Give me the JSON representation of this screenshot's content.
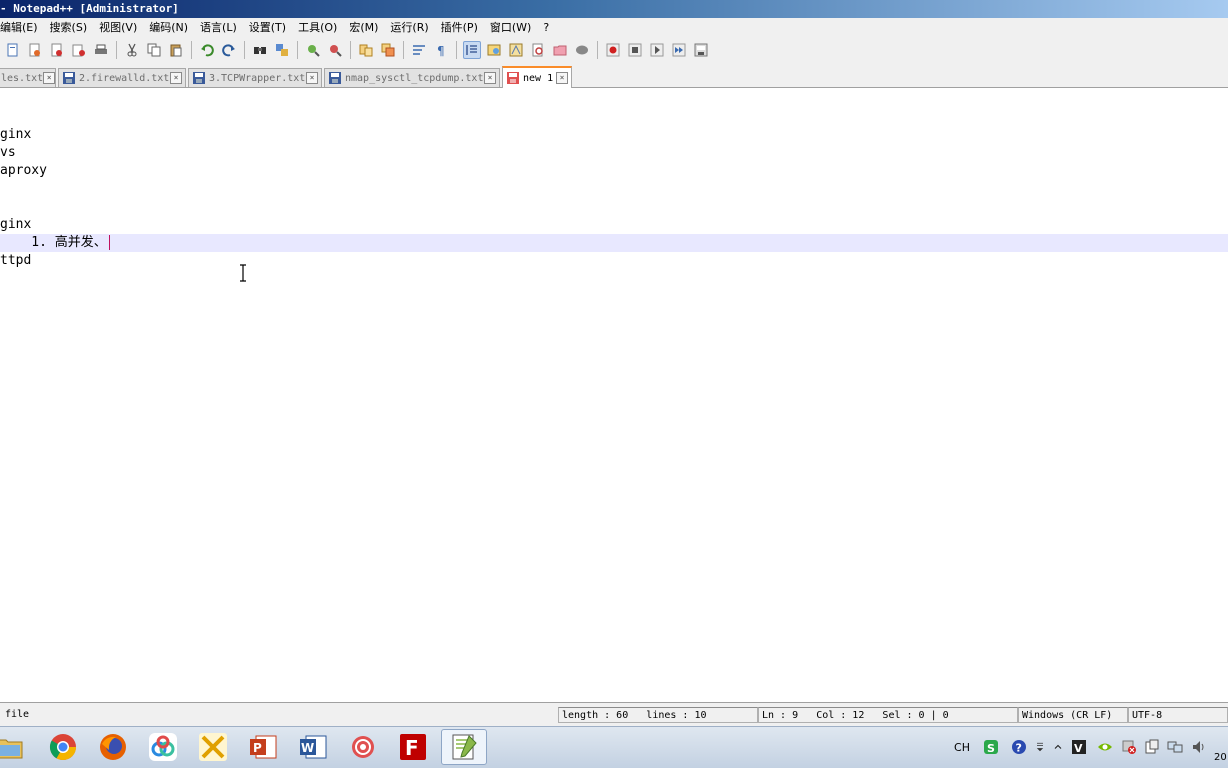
{
  "window": {
    "title": "- Notepad++ [Administrator]"
  },
  "menu": [
    "编辑(E)",
    "搜索(S)",
    "视图(V)",
    "编码(N)",
    "语言(L)",
    "设置(T)",
    "工具(O)",
    "宏(M)",
    "运行(R)",
    "插件(P)",
    "窗口(W)",
    "?"
  ],
  "toolbar": {
    "icons": [
      "new-file-icon",
      "open-file-icon",
      "close-file-icon",
      "close-all-icon",
      "print-icon",
      "cut-icon",
      "copy-icon",
      "paste-icon",
      "undo-icon",
      "redo-icon",
      "find-icon",
      "replace-icon",
      "zoom-in-icon",
      "zoom-out-icon",
      "sync-vertical-icon",
      "sync-horizontal-icon",
      "word-wrap-icon",
      "show-all-chars-icon",
      "indent-guide-icon",
      "lang-udl-icon",
      "doc-map-icon",
      "function-list-icon",
      "folder-workspace-icon",
      "monitoring-icon",
      "record-macro-icon",
      "stop-macro-icon",
      "play-macro-icon",
      "run-multiple-macro-icon",
      "save-macro-icon"
    ]
  },
  "tabs": [
    {
      "label": "les.txt",
      "active": false
    },
    {
      "label": "2.firewalld.txt",
      "active": false
    },
    {
      "label": "3.TCPWrapper.txt",
      "active": false
    },
    {
      "label": "nmap_sysctl_tcpdump.txt",
      "active": false
    },
    {
      "label": "new 1",
      "active": true
    }
  ],
  "editor": {
    "lines": [
      "",
      "",
      "ginx",
      "vs",
      "aproxy",
      "",
      "",
      "ginx",
      "    1. 高并发、",
      "ttpd"
    ],
    "current_line": 8
  },
  "status": {
    "file_type": "file",
    "length": "length : 60",
    "lines": "lines : 10",
    "ln": "Ln : 9",
    "col": "Col : 12",
    "sel": "Sel : 0 | 0",
    "eol": "Windows (CR LF)",
    "encoding": "UTF-8"
  },
  "taskbar": {
    "apps": [
      "file-explorer-icon",
      "chrome-icon",
      "firefox-icon",
      "baidu-netdisk-icon",
      "xmanager-icon",
      "powerpoint-icon",
      "word-icon",
      "snail-app-icon",
      "filezilla-icon",
      "notepad-plus-plus-icon"
    ],
    "tray": {
      "ime": "CH",
      "clock_partial": "20"
    }
  }
}
